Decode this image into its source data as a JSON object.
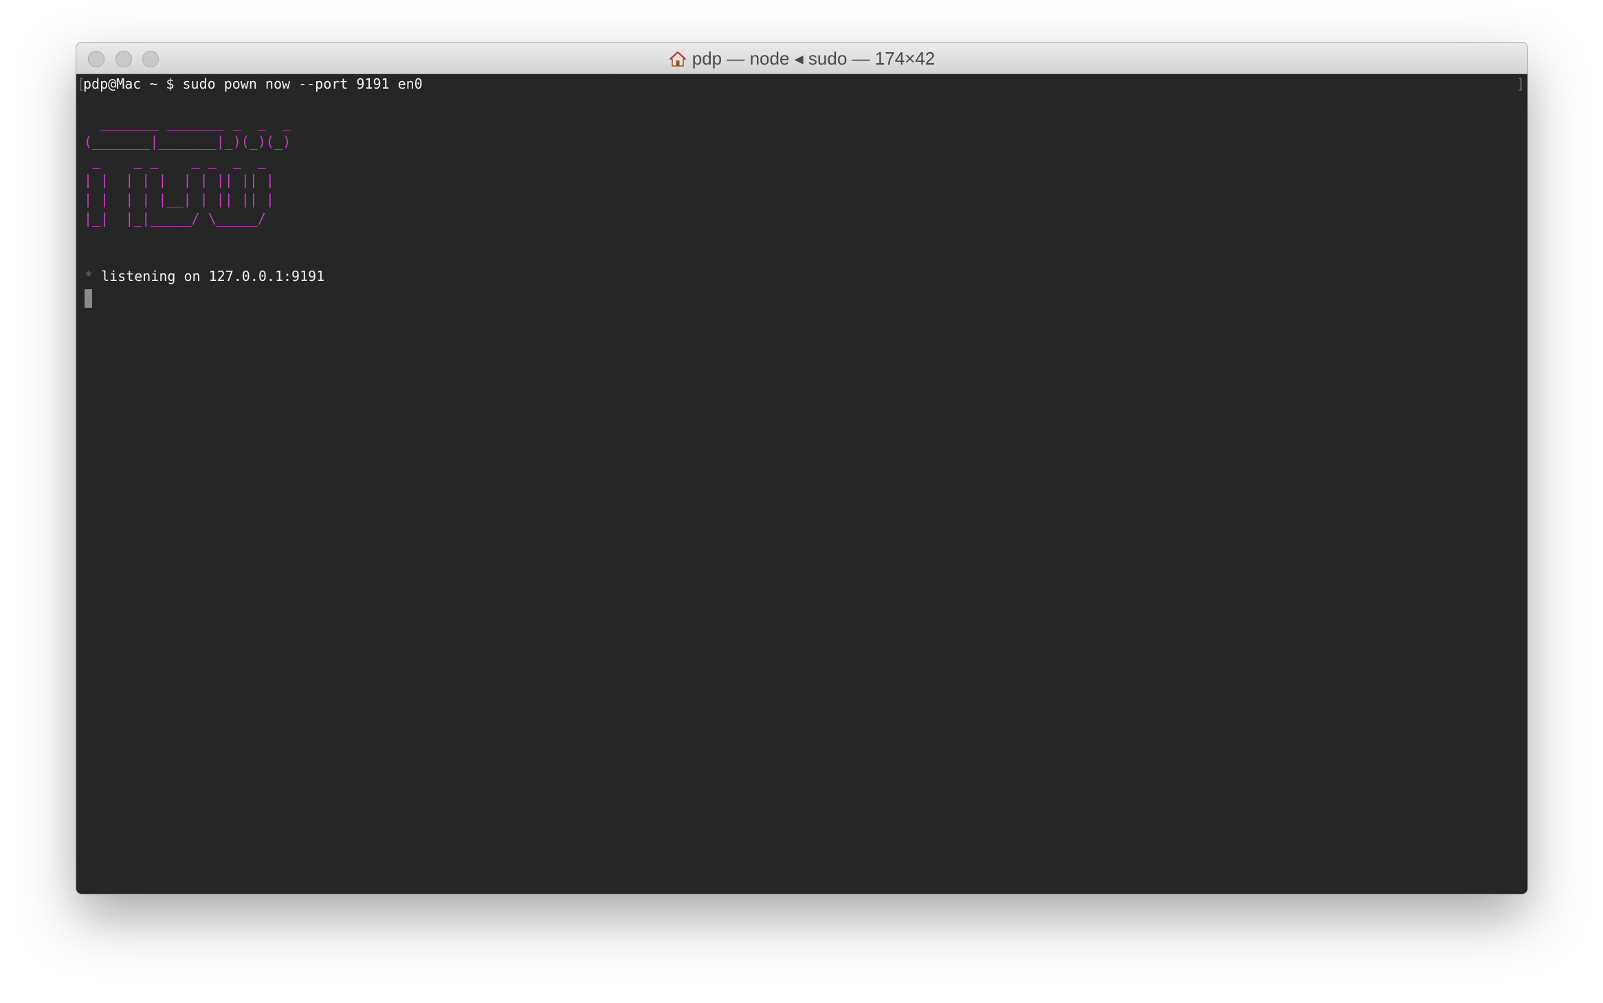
{
  "window": {
    "title": "pdp — node ◂ sudo — 174×42"
  },
  "icons": {
    "title_icon": "home-icon",
    "window_controls": [
      "close-button",
      "minimize-button",
      "zoom-button"
    ]
  },
  "terminal": {
    "prompt": "pdp@Mac ~ $",
    "command": "sudo pown now --port 9191 en0",
    "banner": "  _______ _______ _  _  _ \n(_______|_______|_)(_)(_)\n _    _ _    _ _  _  _ \n| |  | | |  | | || || |\n| |  | | |__| | || || |\n|_|  |_|_____/ \\_____/",
    "status_marker": "*",
    "status_text": "listening on 127.0.0.1:9191",
    "banner_color": "#c53ec5",
    "background_color": "#262626",
    "text_color": "#f2f2f2"
  }
}
